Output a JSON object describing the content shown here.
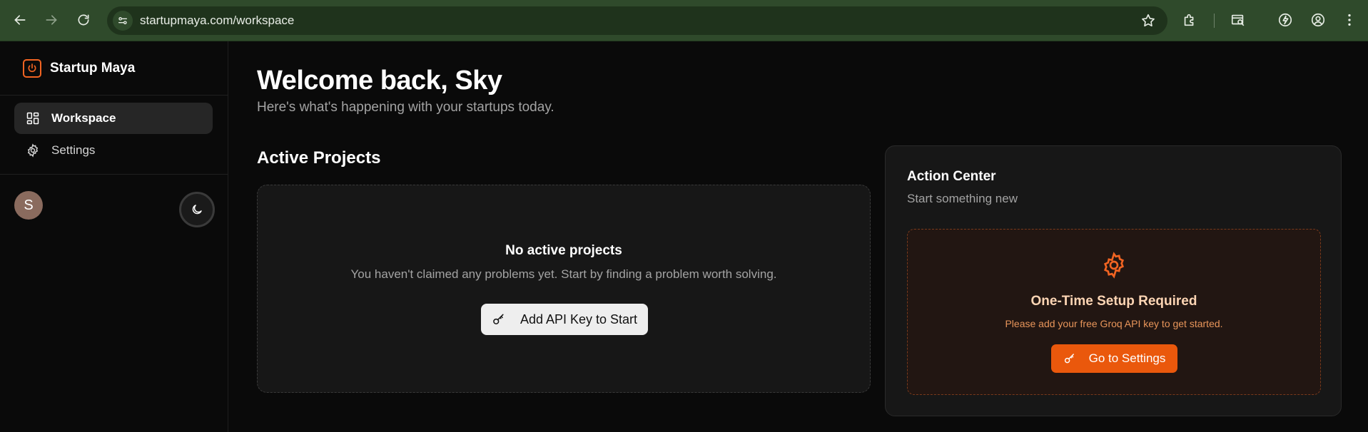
{
  "browser": {
    "url": "startupmaya.com/workspace"
  },
  "sidebar": {
    "brand_name": "Startup Maya",
    "items": [
      {
        "label": "Workspace",
        "active": true
      },
      {
        "label": "Settings",
        "active": false
      }
    ],
    "avatar_initial": "S"
  },
  "main": {
    "welcome": "Welcome back, Sky",
    "subtitle": "Here's what's happening with your startups today.",
    "projects_title": "Active Projects",
    "empty_title": "No active projects",
    "empty_desc": "You haven't claimed any problems yet. Start by finding a problem worth solving.",
    "api_button": "Add API Key to Start"
  },
  "action_center": {
    "title": "Action Center",
    "subtitle": "Start something new",
    "setup_title": "One-Time Setup Required",
    "setup_desc": "Please add your free Groq API key to get started.",
    "settings_button": "Go to Settings"
  },
  "colors": {
    "accent": "#ea580c",
    "background": "#0a0a0a",
    "card": "#171717",
    "chrome": "#2f4a2b"
  }
}
